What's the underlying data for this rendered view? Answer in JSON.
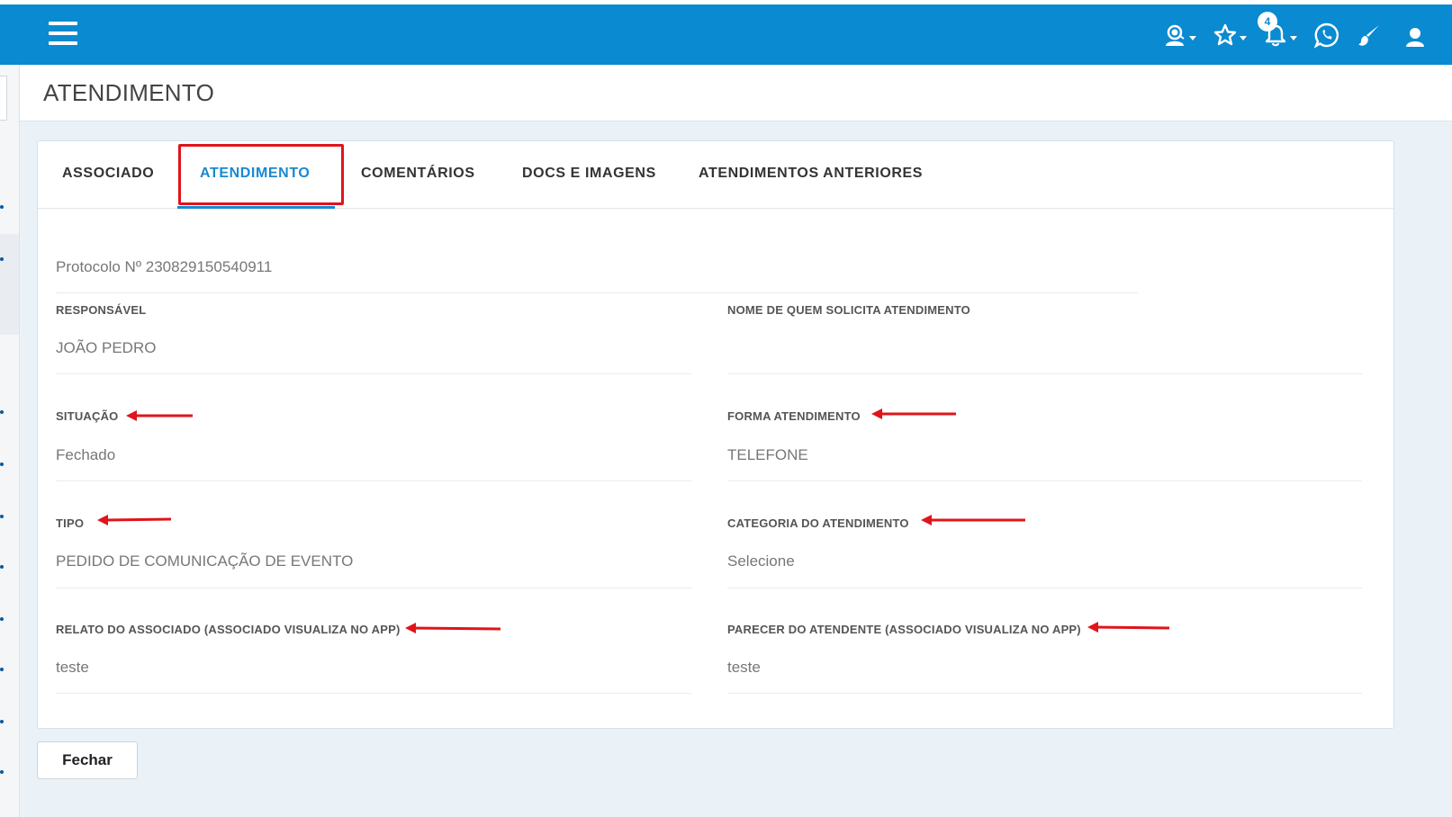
{
  "header": {
    "notification_count": "4",
    "icons": [
      "support-agent-icon",
      "star-icon",
      "bell-icon",
      "whatsapp-icon",
      "brush-icon",
      "user-icon"
    ]
  },
  "page": {
    "title": "ATENDIMENTO"
  },
  "tabs": [
    {
      "label": "ASSOCIADO"
    },
    {
      "label": "ATENDIMENTO",
      "active": true
    },
    {
      "label": "COMENTÁRIOS"
    },
    {
      "label": "DOCS E IMAGENS"
    },
    {
      "label": "ATENDIMENTOS ANTERIORES"
    }
  ],
  "form": {
    "protocol": "Protocolo Nº 230829150540911",
    "responsavel": {
      "label": "RESPONSÁVEL",
      "value": "JOÃO PEDRO"
    },
    "solicitante": {
      "label": "NOME DE QUEM SOLICITA ATENDIMENTO",
      "value": ""
    },
    "situacao": {
      "label": "SITUAÇÃO",
      "value": "Fechado"
    },
    "forma": {
      "label": "FORMA ATENDIMENTO",
      "value": "TELEFONE"
    },
    "tipo": {
      "label": "TIPO",
      "value": "PEDIDO DE COMUNICAÇÃO DE EVENTO"
    },
    "categoria": {
      "label": "CATEGORIA DO ATENDIMENTO",
      "value": "Selecione"
    },
    "relato": {
      "label": "RELATO DO ASSOCIADO (ASSOCIADO VISUALIZA NO APP)",
      "value": "teste"
    },
    "parecer": {
      "label": "PARECER DO ATENDENTE (ASSOCIADO VISUALIZA NO APP)",
      "value": "teste"
    }
  },
  "actions": {
    "close_label": "Fechar"
  },
  "colors": {
    "topbar": "#0a8ad0",
    "active_tab": "#1a88d0",
    "annotation": "#e0141a"
  }
}
